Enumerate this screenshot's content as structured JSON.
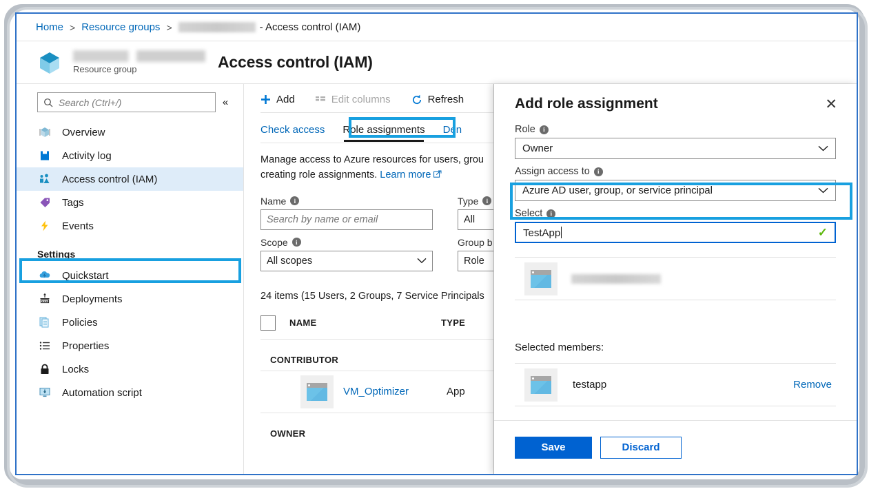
{
  "breadcrumb": {
    "home": "Home",
    "resource_groups": "Resource groups",
    "separator": ">",
    "tail": "- Access control (IAM)"
  },
  "resource_header": {
    "subtitle": "Resource group",
    "title": "Access control (IAM)",
    "icon": "resource-group-cube-icon"
  },
  "sidebar": {
    "search_placeholder": "Search (Ctrl+/)",
    "collapse_glyph": "«",
    "items": [
      {
        "label": "Overview",
        "icon": "cube-outline-icon"
      },
      {
        "label": "Activity log",
        "icon": "log-book-icon"
      },
      {
        "label": "Access control (IAM)",
        "icon": "people-access-icon"
      },
      {
        "label": "Tags",
        "icon": "tag-icon"
      },
      {
        "label": "Events",
        "icon": "lightning-bolt-icon"
      }
    ],
    "section_label": "Settings",
    "settings_items": [
      {
        "label": "Quickstart",
        "icon": "cloud-bolt-icon"
      },
      {
        "label": "Deployments",
        "icon": "deployment-icon"
      },
      {
        "label": "Policies",
        "icon": "documents-icon"
      },
      {
        "label": "Properties",
        "icon": "list-icon"
      },
      {
        "label": "Locks",
        "icon": "lock-icon"
      },
      {
        "label": "Automation script",
        "icon": "monitor-download-icon"
      }
    ]
  },
  "toolbar": {
    "add": "Add",
    "edit_columns": "Edit columns",
    "refresh": "Refresh"
  },
  "tabs": [
    {
      "label": "Check access",
      "active": false
    },
    {
      "label": "Role assignments",
      "active": true
    },
    {
      "label": "Den",
      "active": false
    }
  ],
  "description": {
    "text": "Manage access to Azure resources for users, grou",
    "text2": "creating role assignments.",
    "link": "Learn more",
    "external_glyph": "↗"
  },
  "filters": {
    "name_label": "Name",
    "name_placeholder": "Search by name or email",
    "type_label": "Type",
    "type_value": "All",
    "scope_label": "Scope",
    "scope_value": "All scopes",
    "group_by_label": "Group b",
    "group_by_value": "Role"
  },
  "item_count": "24 items (15 Users, 2 Groups, 7 Service Principals",
  "table": {
    "columns": [
      "NAME",
      "TYPE"
    ],
    "groups": [
      {
        "label": "CONTRIBUTOR",
        "rows": [
          {
            "name": "VM_Optimizer",
            "type": "App",
            "icon": "app-window-icon"
          }
        ]
      },
      {
        "label": "OWNER",
        "rows": []
      }
    ]
  },
  "blade": {
    "title": "Add role assignment",
    "close_glyph": "✕",
    "role": {
      "label": "Role",
      "value": "Owner"
    },
    "assign_access_to": {
      "label": "Assign access to",
      "value": "Azure AD user, group, or service principal"
    },
    "select": {
      "label": "Select",
      "value": "TestApp",
      "valid_glyph": "✓"
    },
    "results": [
      {
        "name_redacted": true,
        "icon": "app-window-icon"
      }
    ],
    "selected_members_label": "Selected members:",
    "selected_members": [
      {
        "name": "testapp",
        "icon": "app-window-icon",
        "remove_label": "Remove"
      }
    ],
    "save_label": "Save",
    "discard_label": "Discard"
  },
  "colors": {
    "accent_blue": "#0067b8",
    "button_blue": "#0062d1",
    "highlight_cyan": "#18a0e0",
    "selected_nav_bg": "#deecf9",
    "valid_green": "#5cb70b",
    "frame_blue": "#2f72c8"
  }
}
